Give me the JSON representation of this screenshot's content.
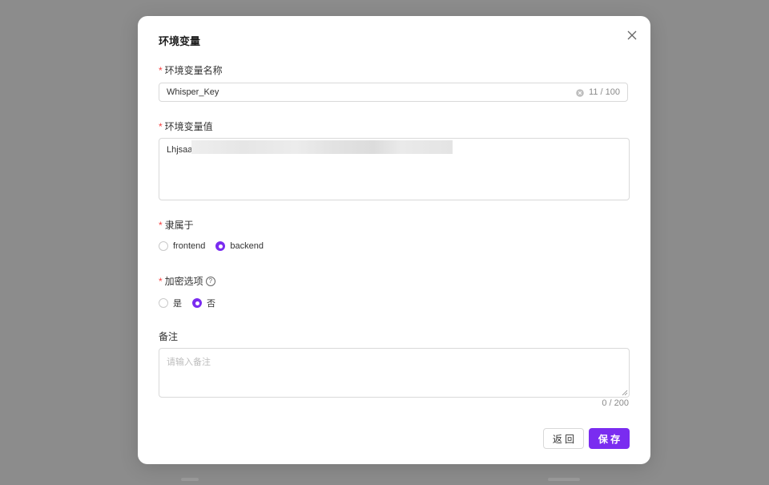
{
  "dialog": {
    "title": "环境变量",
    "name_field": {
      "label": "环境变量名称",
      "value": "Whisper_Key",
      "counter": "11 / 100"
    },
    "value_field": {
      "label": "环境变量值",
      "value": "Lhjsaal"
    },
    "belongs_to": {
      "label": "隶属于",
      "options": [
        "frontend",
        "backend"
      ],
      "selected": "backend"
    },
    "encrypt": {
      "label": "加密选项",
      "help": "?",
      "options": [
        "是",
        "否"
      ],
      "selected": "否"
    },
    "note": {
      "label": "备注",
      "placeholder": "请输入备注",
      "counter": "0 / 200"
    },
    "buttons": {
      "back": "返 回",
      "save": "保 存"
    }
  },
  "colors": {
    "accent": "#7a2cf0",
    "required": "#f53f3f",
    "overlay": "#8c8c8c"
  },
  "icons": {
    "close": "close-icon",
    "clear": "clear-circle-icon",
    "help": "question-circle-icon",
    "resize": "resize-handle-icon"
  }
}
